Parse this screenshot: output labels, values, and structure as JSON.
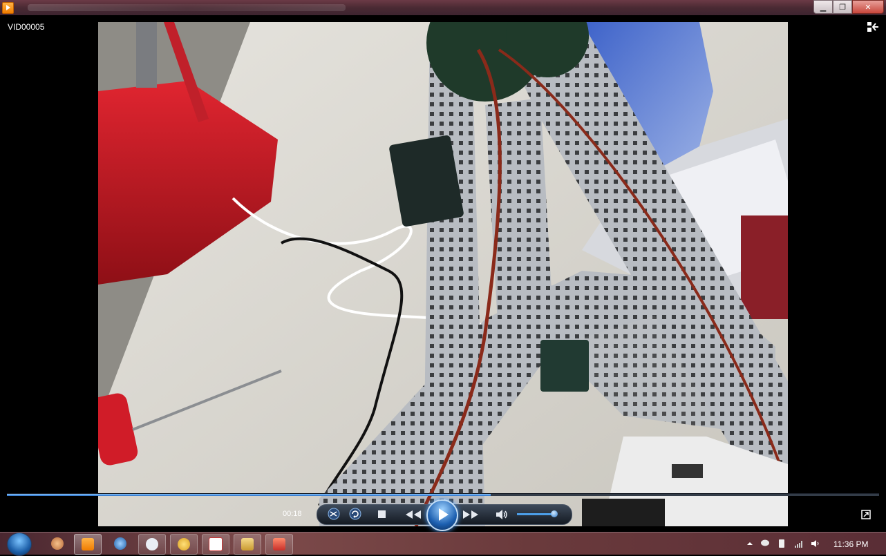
{
  "window": {
    "title": "VID00005",
    "controls": [
      "minimize",
      "restore",
      "close"
    ]
  },
  "player": {
    "elapsed": "00:18",
    "seek_progress_fraction": 0.555,
    "volume_fraction": 0.85,
    "buttons": {
      "shuffle": "shuffle-icon",
      "repeat": "repeat-icon",
      "stop": "stop-icon",
      "previous": "previous-icon",
      "play": "play-icon",
      "next": "next-icon",
      "mute": "speaker-icon",
      "fullscreen": "fullscreen-icon",
      "switch_library": "switch-to-library-icon"
    }
  },
  "video": {
    "frame_description_icon": "video-frame"
  },
  "taskbar": {
    "start": "windows-start-orb",
    "buttons": [
      {
        "name": "paint",
        "icon": "paint-icon",
        "state": "normal"
      },
      {
        "name": "media-player",
        "icon": "media-player-icon",
        "state": "active"
      },
      {
        "name": "browser",
        "icon": "browser-icon",
        "state": "normal"
      },
      {
        "name": "messenger",
        "icon": "chat-icon",
        "state": "open"
      },
      {
        "name": "winamp",
        "icon": "winamp-icon",
        "state": "open"
      },
      {
        "name": "app-easy",
        "icon": "app-icon",
        "state": "open"
      },
      {
        "name": "explorer",
        "icon": "folder-icon",
        "state": "open"
      },
      {
        "name": "app-red",
        "icon": "app-icon",
        "state": "open"
      }
    ],
    "tray": [
      "show-hidden-icon",
      "chat-bubble-icon",
      "usb-icon",
      "network-icon",
      "volume-icon"
    ],
    "clock": "11:36 PM"
  }
}
